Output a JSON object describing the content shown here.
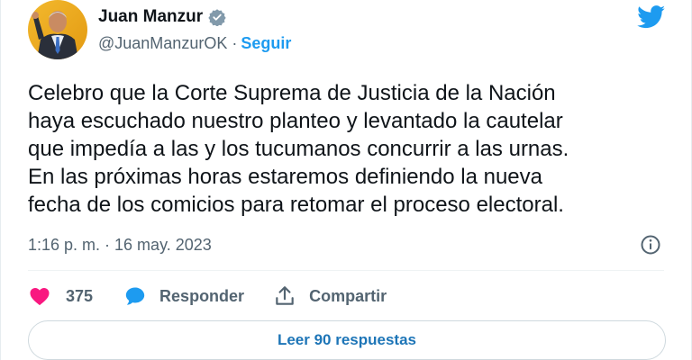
{
  "author": {
    "name": "Juan Manzur",
    "handle": "@JuanManzurOK",
    "separator": "·",
    "follow_label": "Seguir"
  },
  "tweet": {
    "lines": [
      "Celebro que la Corte Suprema de Justicia de la Nación",
      "haya escuchado nuestro planteo y levantado la cautelar",
      "que impedía a las y los tucumanos concurrir a las urnas.",
      "En las próximas horas estaremos definiendo la nueva",
      "fecha de los comicios para retomar el proceso electoral."
    ],
    "timestamp": "1:16 p. m. · 16 may. 2023"
  },
  "actions": {
    "like_count": "375",
    "reply_label": "Responder",
    "share_label": "Compartir"
  },
  "read_replies_label": "Leer 90 respuestas",
  "colors": {
    "brand_blue": "#1d9bf0",
    "like_pink": "#f91880",
    "text_primary": "#0f1419",
    "text_secondary": "#536471",
    "verified_gray": "#829aab"
  },
  "icons": {
    "verified": "verified-badge-icon",
    "logo": "twitter-bird-icon",
    "info": "info-icon",
    "like": "heart-icon",
    "reply": "speech-bubble-icon",
    "share": "share-upload-icon"
  }
}
